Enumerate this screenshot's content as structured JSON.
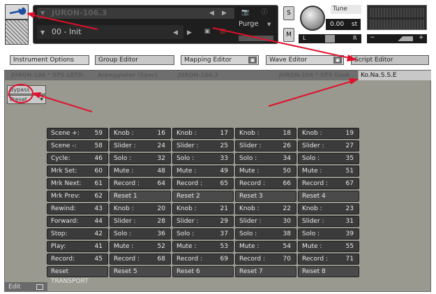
{
  "instrument": {
    "name": "JURON-106.3",
    "preset": "00 - Init",
    "purge_label": "Purge",
    "s_label": "S",
    "m_label": "M",
    "tune_label": "Tune",
    "tune_value": "0.00",
    "tune_unit": "st",
    "pan_left": "L",
    "pan_right": "R"
  },
  "tabs": {
    "instrument_options": "Instrument Options",
    "group_editor": "Group Editor",
    "mapping_editor": "Mapping Editor",
    "wave_editor": "Wave Editor",
    "script_editor": "Script Editor"
  },
  "script_tabs": [
    "JURON-106 * XPS LRTD-",
    "Arpeggiator (Sync)",
    "JURON-106.3",
    "JURON-106 * XPS Usok"
  ],
  "script_title": "Ko.Na.S.S.E",
  "bypass_label": "Bypass",
  "preset_label": "Preset",
  "edit_label": "Edit",
  "transport": [
    {
      "label": "Scene +:",
      "value": "59"
    },
    {
      "label": "Scene -:",
      "value": "58"
    },
    {
      "label": "Cycle:",
      "value": "46"
    },
    {
      "label": "Mrk Set:",
      "value": "60"
    },
    {
      "label": "Mrk Next:",
      "value": "61"
    },
    {
      "label": "Mrk Prev:",
      "value": "62"
    },
    {
      "label": "Rewind:",
      "value": "43"
    },
    {
      "label": "Forward:",
      "value": "44"
    },
    {
      "label": "Stop:",
      "value": "42"
    },
    {
      "label": "Play:",
      "value": "41"
    },
    {
      "label": "Record:",
      "value": "45"
    },
    {
      "label": "Reset TRANSPORT",
      "value": ""
    }
  ],
  "channels_top": [
    {
      "knob": "16",
      "slider": "24",
      "solo": "32",
      "mute": "48",
      "record": "64",
      "reset": "Reset 1"
    },
    {
      "knob": "17",
      "slider": "25",
      "solo": "33",
      "mute": "49",
      "record": "65",
      "reset": "Reset 2"
    },
    {
      "knob": "18",
      "slider": "26",
      "solo": "34",
      "mute": "50",
      "record": "66",
      "reset": "Reset 3"
    },
    {
      "knob": "19",
      "slider": "27",
      "solo": "35",
      "mute": "51",
      "record": "67",
      "reset": "Reset 4"
    }
  ],
  "channels_bottom": [
    {
      "knob": "20",
      "slider": "28",
      "solo": "36",
      "mute": "52",
      "record": "68",
      "reset": "Reset 5"
    },
    {
      "knob": "21",
      "slider": "29",
      "solo": "37",
      "mute": "53",
      "record": "69",
      "reset": "Reset 6"
    },
    {
      "knob": "22",
      "slider": "30",
      "solo": "38",
      "mute": "54",
      "record": "70",
      "reset": "Reset 7"
    },
    {
      "knob": "23",
      "slider": "31",
      "solo": "39",
      "mute": "55",
      "record": "71",
      "reset": "Reset 8"
    }
  ],
  "row_labels": {
    "knob": "Knob :",
    "slider": "Slider :",
    "solo": "Solo :",
    "mute": "Mute :",
    "record": "Record :"
  },
  "colors": {
    "annotation": "#e0102a",
    "panel_bg": "#999990",
    "cell_bg": "#3b3b3b"
  }
}
